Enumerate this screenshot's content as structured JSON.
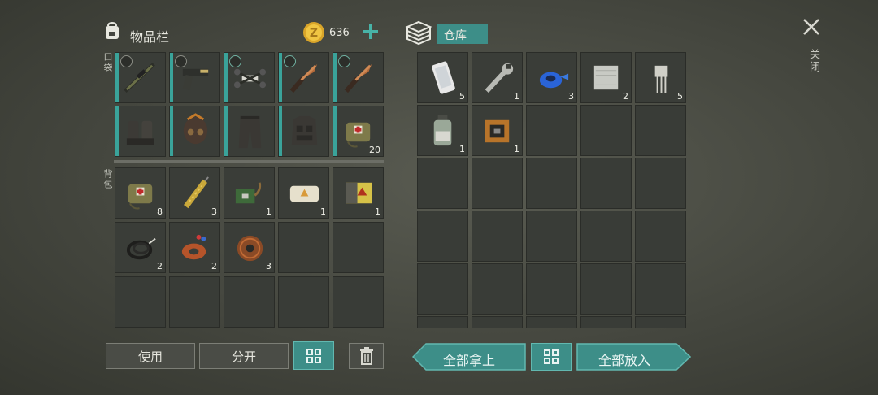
{
  "header": {
    "inventory_title": "物品栏",
    "coins": "636",
    "storage_title": "仓库",
    "close_label": "关闭"
  },
  "side_labels": {
    "pockets": "口袋",
    "backpack": "背包"
  },
  "pockets": [
    {
      "icon": "sniper-rifle-icon",
      "count": "",
      "badge": "shield"
    },
    {
      "icon": "pistol-icon",
      "count": "",
      "badge": "shield"
    },
    {
      "icon": "drone-icon",
      "count": "",
      "badge": "medical"
    },
    {
      "icon": "knife-icon",
      "count": "",
      "badge": "medical"
    },
    {
      "icon": "knife-icon",
      "count": "",
      "badge": "medical"
    },
    {
      "icon": "boots-icon",
      "count": ""
    },
    {
      "icon": "helmet-icon",
      "count": ""
    },
    {
      "icon": "pants-icon",
      "count": ""
    },
    {
      "icon": "body-armor-icon",
      "count": ""
    },
    {
      "icon": "medkit-bag-icon",
      "count": "20"
    }
  ],
  "backpack": [
    {
      "icon": "medkit-bag-icon",
      "count": "8"
    },
    {
      "icon": "syringe-icon",
      "count": "3"
    },
    {
      "icon": "circuit-board-icon",
      "count": "1"
    },
    {
      "icon": "bandage-pack-icon",
      "count": "1"
    },
    {
      "icon": "battery-icon",
      "count": "1"
    },
    {
      "icon": "cable-icon",
      "count": "2"
    },
    {
      "icon": "copper-coil-icon",
      "count": "2"
    },
    {
      "icon": "wire-spool-icon",
      "count": "3"
    }
  ],
  "storage": [
    {
      "icon": "smartphone-icon",
      "count": "5"
    },
    {
      "icon": "wrench-icon",
      "count": "1"
    },
    {
      "icon": "tape-roll-icon",
      "count": "3"
    },
    {
      "icon": "foil-sheet-icon",
      "count": "2"
    },
    {
      "icon": "transistor-icon",
      "count": "5"
    },
    {
      "icon": "chemical-jar-icon",
      "count": "1"
    },
    {
      "icon": "chip-board-icon",
      "count": "1"
    }
  ],
  "buttons": {
    "use": "使用",
    "split": "分开",
    "take_all": "全部拿上",
    "put_all": "全部放入"
  },
  "colors": {
    "accent": "#3d8e88",
    "coin": "#e0b22a"
  }
}
